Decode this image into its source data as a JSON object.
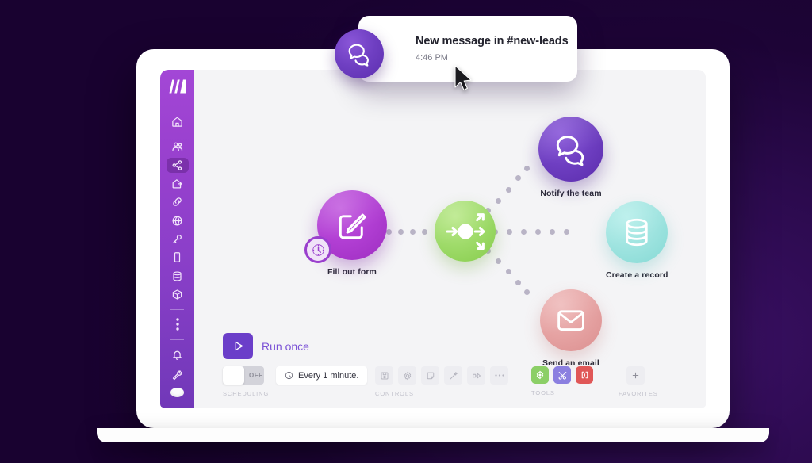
{
  "app": {
    "name": "Make",
    "logo_icon": "make-logo-icon"
  },
  "sidebar": {
    "items": [
      {
        "icon": "home-icon",
        "name": "home",
        "active": false
      },
      {
        "icon": "team-icon",
        "name": "organization",
        "active": false
      },
      {
        "icon": "share-nodes-icon",
        "name": "scenarios",
        "active": true
      },
      {
        "icon": "templates-icon",
        "name": "templates",
        "active": false
      },
      {
        "icon": "link-icon",
        "name": "connections",
        "active": false
      },
      {
        "icon": "globe-icon",
        "name": "webhooks",
        "active": false
      },
      {
        "icon": "key-icon",
        "name": "keys",
        "active": false
      },
      {
        "icon": "device-icon",
        "name": "devices",
        "active": false
      },
      {
        "icon": "database-icon",
        "name": "data-stores",
        "active": false
      },
      {
        "icon": "package-icon",
        "name": "data-structures",
        "active": false
      },
      {
        "icon": "more-vertical-icon",
        "name": "more",
        "active": false
      }
    ],
    "bottom_items": [
      {
        "icon": "bell-icon",
        "name": "notifications"
      },
      {
        "icon": "wrench-icon",
        "name": "settings"
      }
    ],
    "avatar": "user-avatar"
  },
  "toast": {
    "icon": "chat-bubbles-icon",
    "title": "New message in #new-leads",
    "time": "4:46 PM"
  },
  "flow": {
    "nodes": [
      {
        "id": "fill-out-form",
        "label": "Fill out form",
        "icon": "edit-square-icon",
        "color": "#b23fd4",
        "badge": "clock-icon"
      },
      {
        "id": "router",
        "label": "",
        "icon": "router-arrows-icon",
        "color": "#9fdb6a"
      },
      {
        "id": "notify-the-team",
        "label": "Notify the team",
        "icon": "chat-bubbles-icon",
        "color": "#6f3fc2"
      },
      {
        "id": "create-a-record",
        "label": "Create a record",
        "icon": "database-icon",
        "color": "#9fe4e0"
      },
      {
        "id": "send-an-email",
        "label": "Send an email",
        "icon": "envelope-icon",
        "color": "#e6a3a3"
      }
    ]
  },
  "toolbar": {
    "run_once": {
      "label": "Run once",
      "icon": "play-icon"
    },
    "scheduling": {
      "caption": "SCHEDULING",
      "toggle_state": "OFF",
      "interval_label": "Every 1 minute.",
      "interval_icon": "clock-icon"
    },
    "controls": {
      "caption": "CONTROLS",
      "buttons": [
        {
          "name": "save-button",
          "icon": "save-icon"
        },
        {
          "name": "settings-button",
          "icon": "gear-icon"
        },
        {
          "name": "notes-button",
          "icon": "note-icon"
        },
        {
          "name": "auto-align-button",
          "icon": "magic-wand-icon"
        },
        {
          "name": "explore-button",
          "icon": "flow-arrow-icon"
        },
        {
          "name": "more-options-button",
          "icon": "ellipsis-icon"
        }
      ]
    },
    "tools": {
      "caption": "TOOLS",
      "buttons": [
        {
          "name": "tools-flow-control",
          "icon": "gear-icon",
          "color": "#8ccf67"
        },
        {
          "name": "tools-toolbox",
          "icon": "tools-icon",
          "color": "#8b7fe0"
        },
        {
          "name": "tools-text-parser",
          "icon": "brackets-icon",
          "color": "#e05757"
        }
      ]
    },
    "favorites": {
      "caption": "FAVORITES",
      "add_icon": "plus-icon"
    }
  },
  "colors": {
    "background": "#1d0436",
    "sidebar_top": "#a347d6",
    "sidebar_bottom": "#7138b8",
    "accent_purple": "#6b3ec9",
    "canvas": "#f4f4f6"
  }
}
